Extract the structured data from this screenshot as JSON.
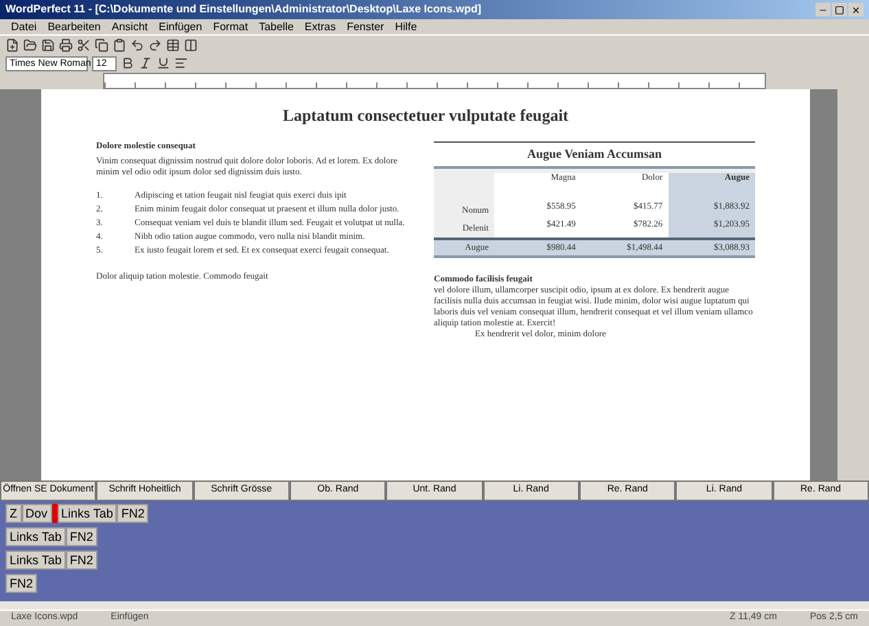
{
  "window": {
    "title": "WordPerfect 11 - [C:\\Dokumente und Einstellungen\\Administrator\\Desktop\\Laxe Icons.wpd]"
  },
  "menu": [
    "Datei",
    "Bearbeiten",
    "Ansicht",
    "Einfügen",
    "Format",
    "Tabelle",
    "Extras",
    "Fenster",
    "Hilfe"
  ],
  "property_bar": {
    "font": "Times New Roman",
    "size": "12"
  },
  "document": {
    "title": "Laptatum consectetuer vulputate feugait",
    "left": {
      "heading": "Dolore molestie consequat",
      "intro": "Vinim consequat dignissim nostrud quit dolore dolor loboris. Ad et lorem. Ex dolore minim vel odio odit ipsum dolor sed dignissim duis iusto.",
      "items": [
        {
          "number": "1.",
          "text": "Adipiscing et tation feugait nisl feugiat quis exerci duis ipit"
        },
        {
          "number": "2.",
          "text": "Enim minim feugait dolor consequat ut praesent et illum nulla dolor justo."
        },
        {
          "number": "3.",
          "text": "Consequat veniam vel duis te blandit illum sed. Feugait et volutpat ut nulla."
        },
        {
          "number": "4.",
          "text": "Nibh odio tation augue commodo, vero nulla nisi blandit minim."
        },
        {
          "number": "5.",
          "text": "Ex iusto feugait lorem et sed. Et ex consequat exerci feugait consequat."
        }
      ],
      "outro": "Dolor aliquip tation molestie. Commodo feugait"
    },
    "table": {
      "title": "Augue Veniam Accumsan",
      "columns": [
        "Magna",
        "Dolor",
        "Augue"
      ],
      "rows": [
        {
          "label": "Nonum",
          "cells": [
            "$558.95",
            "$415.77",
            "$1,883.92"
          ]
        },
        {
          "label": "Delenit",
          "cells": [
            "$421.49",
            "$782.26",
            "$1,203.95"
          ]
        }
      ],
      "total": {
        "label": "Augue",
        "cells": [
          "$980.44",
          "$1,498.44",
          "$3,088.93"
        ]
      }
    },
    "right": {
      "heading": "Commodo facilisis feugait",
      "text": "vel dolore illum, ullamcorper suscipit odio, ipsum at ex dolore. Ex hendrerit augue facilisis nulla duis accumsan in feugiat wisi. Ilude minim, dolor wisi augue luptatum qui laboris duis vel veniam consequat illum, hendrerit consequat et vel illum veniam ullamco aliquip tation molestie at. Exercit!",
      "last": "Ex hendrerit vel dolor, minim dolore"
    }
  },
  "reveal_buttons": [
    "Öffnen SE Dokument",
    "Schrift Hoheitlich",
    "Schrift Grösse",
    "Ob. Rand",
    "Unt. Rand",
    "Li. Rand",
    "Re. Rand",
    "Li. Rand",
    "Re. Rand"
  ],
  "codes": [
    [
      {
        "kind": "code",
        "text": "Z"
      },
      {
        "kind": "code",
        "text": "Dov"
      },
      {
        "kind": "cursor"
      },
      {
        "kind": "code",
        "text": "Links Tab"
      },
      {
        "kind": "code",
        "text": "FN2"
      }
    ],
    [
      {
        "kind": "code",
        "text": "Links Tab"
      },
      {
        "kind": "code",
        "text": "FN2"
      }
    ],
    [
      {
        "kind": "code",
        "text": "Links Tab"
      },
      {
        "kind": "code",
        "text": "FN2"
      }
    ],
    [
      {
        "kind": "code",
        "text": "FN2"
      }
    ]
  ],
  "status_bar": [
    "Laxe Icons.wpd",
    "Einfügen",
    "Z 11,49 cm",
    "Pos 2,5 cm"
  ]
}
